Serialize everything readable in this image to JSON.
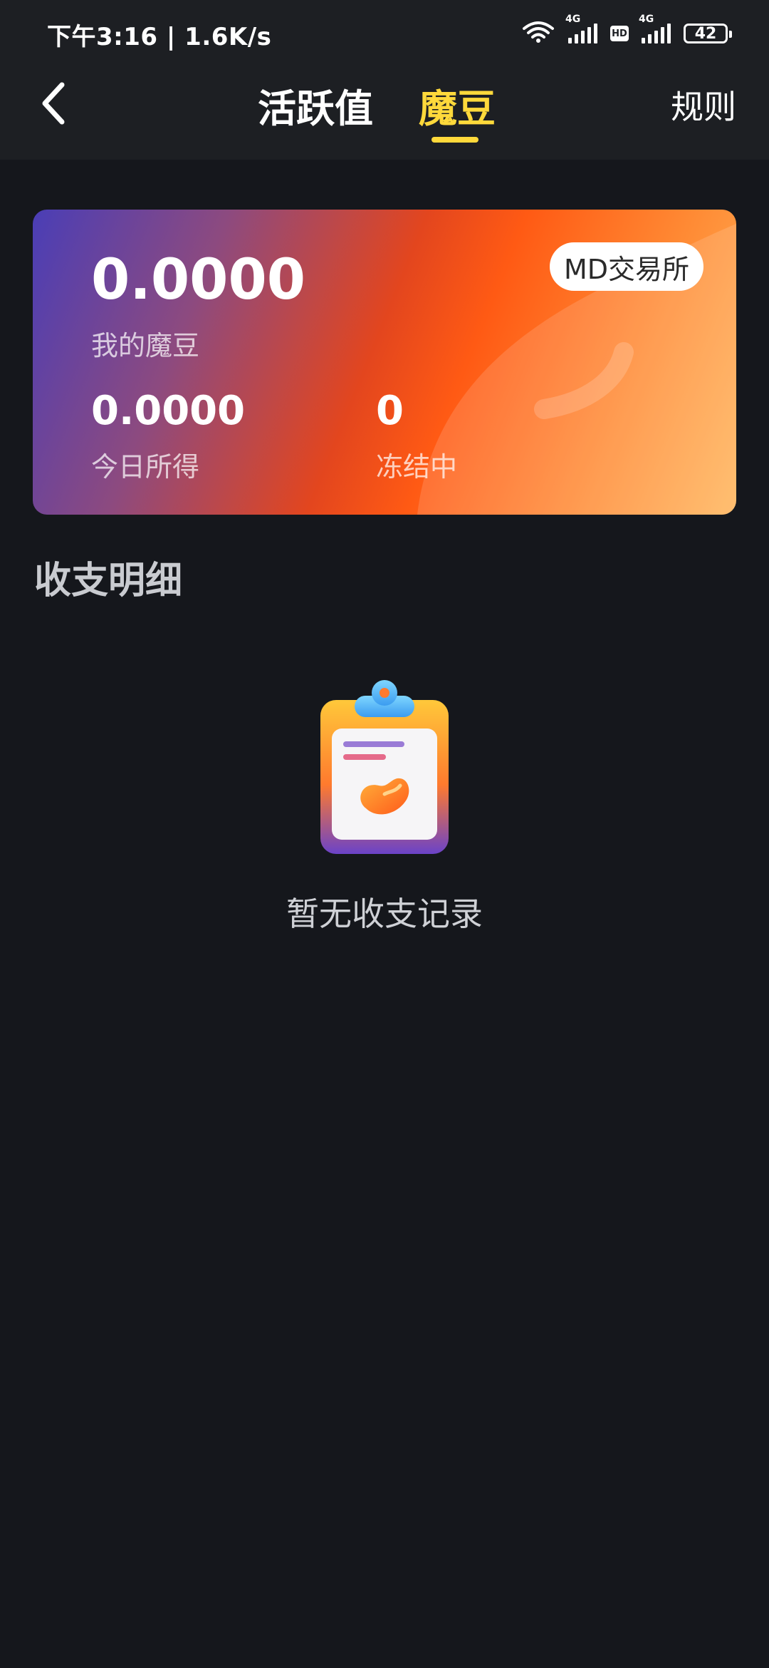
{
  "status_bar": {
    "time": "下午3:16 | 1.6K/s",
    "network_1": "4G",
    "hd": "HD",
    "network_2": "4G",
    "battery": "42"
  },
  "header": {
    "tabs": [
      {
        "label": "活跃值",
        "active": false
      },
      {
        "label": "魔豆",
        "active": true
      }
    ],
    "rules_label": "规则",
    "accent_color": "#ffd93b"
  },
  "card": {
    "exchange_button": "MD交易所",
    "balance": {
      "value": "0.0000",
      "label": "我的魔豆"
    },
    "today": {
      "value": "0.0000",
      "label": "今日所得"
    },
    "frozen": {
      "value": "0",
      "label": "冻结中"
    }
  },
  "section": {
    "title": "收支明细"
  },
  "empty_state": {
    "icon": "clipboard-bean-icon",
    "text": "暂无收支记录"
  }
}
